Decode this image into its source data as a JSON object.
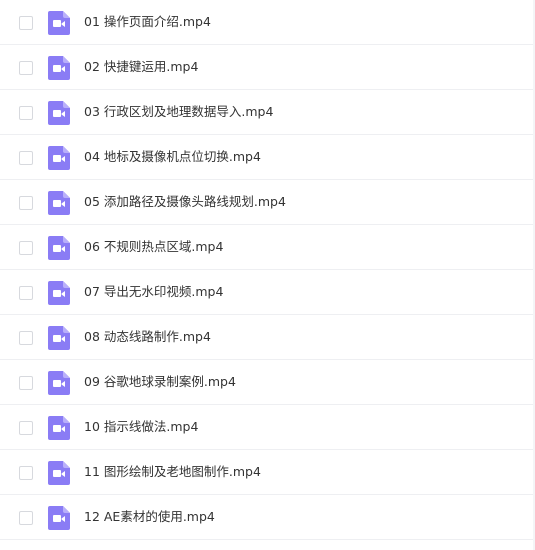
{
  "file_list": {
    "items": [
      {
        "name": "01 操作页面介绍.mp4",
        "icon": "video-file-icon"
      },
      {
        "name": "02 快捷键运用.mp4",
        "icon": "video-file-icon"
      },
      {
        "name": "03 行政区划及地理数据导入.mp4",
        "icon": "video-file-icon"
      },
      {
        "name": "04 地标及摄像机点位切换.mp4",
        "icon": "video-file-icon"
      },
      {
        "name": "05 添加路径及摄像头路线规划.mp4",
        "icon": "video-file-icon"
      },
      {
        "name": "06 不规则热点区域.mp4",
        "icon": "video-file-icon"
      },
      {
        "name": "07 导出无水印视频.mp4",
        "icon": "video-file-icon"
      },
      {
        "name": "08 动态线路制作.mp4",
        "icon": "video-file-icon"
      },
      {
        "name": "09 谷歌地球录制案例.mp4",
        "icon": "video-file-icon"
      },
      {
        "name": "10 指示线做法.mp4",
        "icon": "video-file-icon"
      },
      {
        "name": "11 图形绘制及老地图制作.mp4",
        "icon": "video-file-icon"
      },
      {
        "name": "12 AE素材的使用.mp4",
        "icon": "video-file-icon"
      }
    ],
    "colors": {
      "icon_bg": "#8a7cf5",
      "icon_fold": "#b9b0fa",
      "text": "#333333",
      "divider": "#eeeff2",
      "checkbox_border": "#d7d9de"
    }
  }
}
